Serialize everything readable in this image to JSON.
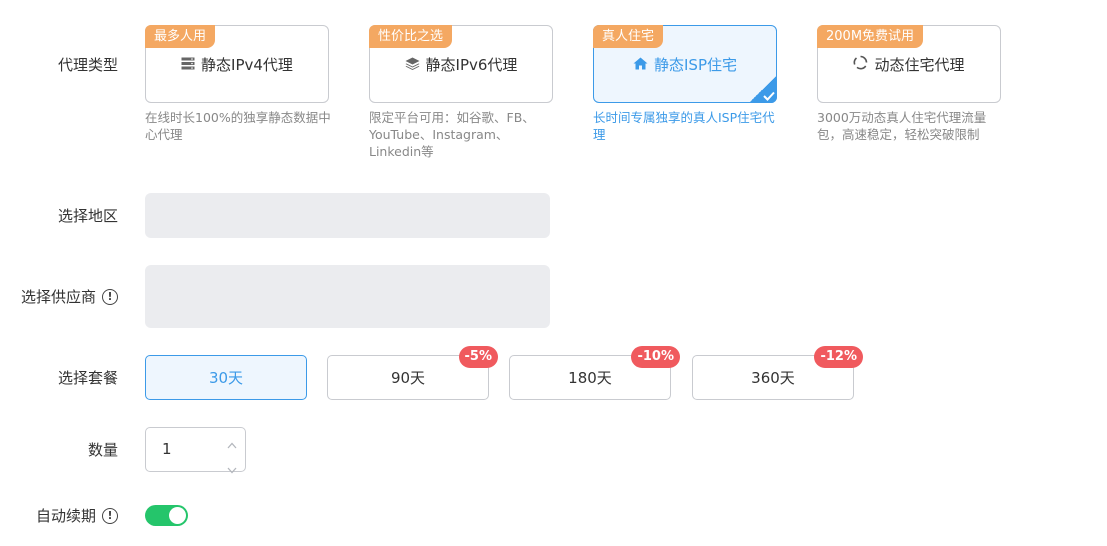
{
  "labels": {
    "proxy_type": "代理类型",
    "region": "选择地区",
    "provider": "选择供应商",
    "package": "选择套餐",
    "quantity": "数量",
    "auto_renew": "自动续期"
  },
  "proxy_types": [
    {
      "badge": "最多人用",
      "title": "静态IPv4代理",
      "icon": "server-icon",
      "desc": "在线时长100%的独享静态数据中心代理",
      "selected": false
    },
    {
      "badge": "性价比之选",
      "title": "静态IPv6代理",
      "icon": "layers-icon",
      "desc": "限定平台可用：如谷歌、FB、YouTube、Instagram、Linkedin等",
      "selected": false
    },
    {
      "badge": "真人住宅",
      "title": "静态ISP住宅",
      "icon": "home-icon",
      "desc": "长时间专属独享的真人ISP住宅代理",
      "selected": true
    },
    {
      "badge": "200M免费试用",
      "title": "动态住宅代理",
      "icon": "refresh-icon",
      "desc": "3000万动态真人住宅代理流量包，高速稳定，轻松突破限制",
      "selected": false
    }
  ],
  "packages": [
    {
      "label": "30天",
      "discount": "",
      "selected": true
    },
    {
      "label": "90天",
      "discount": "-5%",
      "selected": false
    },
    {
      "label": "180天",
      "discount": "-10%",
      "selected": false
    },
    {
      "label": "360天",
      "discount": "-12%",
      "selected": false
    }
  ],
  "quantity": {
    "value": "1"
  },
  "auto_renew": {
    "on": true
  },
  "colors": {
    "accent": "#3c9ae8",
    "badge": "#f4a862",
    "discount": "#f05a5e",
    "toggle_on": "#25c56b",
    "select_bg": "#ebecef"
  }
}
